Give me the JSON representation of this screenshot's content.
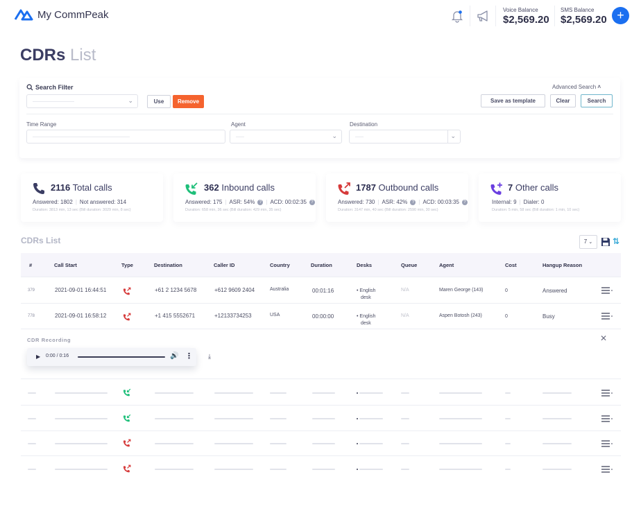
{
  "app": {
    "name": "My CommPeak"
  },
  "header": {
    "notifications_icon": "bell-icon",
    "announcements_icon": "megaphone-icon",
    "voice_balance_label": "Voice Balance",
    "voice_balance_value": "$2,569.20",
    "sms_balance_label": "SMS Balance",
    "sms_balance_value": "$2,569.20",
    "add_label": "+"
  },
  "page": {
    "title_bold": "CDRs",
    "title_light": "List"
  },
  "filter": {
    "search_filter_label": "Search Filter",
    "use_label": "Use",
    "remove_label": "Remove",
    "advanced_search_label": "Advanced Search",
    "save_template_label": "Save as template",
    "clear_label": "Clear",
    "search_label": "Search",
    "time_range_label": "Time Range",
    "agent_label": "Agent",
    "destination_label": "Destination"
  },
  "stats": [
    {
      "count": "2116",
      "label": "Total calls",
      "color": "#3b3d63",
      "parts": [
        "Answered: 1802",
        "Not answered: 314"
      ],
      "duration": "Duration: 3813 min, 13 sec (Bill duration: 3029 min, 8 sec)"
    },
    {
      "count": "362",
      "label": "Inbound calls",
      "color": "#1fbf7a",
      "parts": [
        "Answered: 175",
        "ASR: 54%",
        "ACD: 00:02:35"
      ],
      "duration": "Duration: 658 min, 36 sec (Bill duration: 429 min, 35 sec)"
    },
    {
      "count": "1787",
      "label": "Outbound calls",
      "color": "#d63a3a",
      "parts": [
        "Answered: 730",
        "ASR: 42%",
        "ACD: 00:03:35"
      ],
      "duration": "Duration: 3147 min, 40 sec (Bill duration: 2590 min, 30 sec)"
    },
    {
      "count": "7",
      "label": "Other calls",
      "color": "#6a3fe0",
      "parts": [
        "Internal: 9",
        "Dialer: 0"
      ],
      "duration": "Duration: 5 min, 58 sec (Bill duration: 1 min, 10 sec)"
    }
  ],
  "list": {
    "title": "CDRs List",
    "page_size": "7",
    "columns": [
      "#",
      "Call Start",
      "Type",
      "Destination",
      "Caller ID",
      "Country",
      "Duration",
      "Desks",
      "Queue",
      "Agent",
      "Cost",
      "Hangup Reason"
    ],
    "rows": [
      {
        "id": "379",
        "call_start": "2021-09-01 16:44:51",
        "type": "outbound",
        "destination": "+61 2 1234 5678",
        "caller_id": "+612 9609 2404",
        "country": "Australia",
        "duration": "00:01:16",
        "desk_line1": "• English",
        "desk_line2": "desk",
        "queue": "N/A",
        "agent": "Maren George (143)",
        "cost": "0",
        "hangup_reason": "Answered"
      },
      {
        "id": "778",
        "call_start": "2021-09-01 16:58:12",
        "type": "outbound",
        "destination": "+1 415 5552671",
        "caller_id": "+12133734253",
        "country": "USA",
        "duration": "00:00:00",
        "desk_line1": "• English",
        "desk_line2": "desk",
        "queue": "N/A",
        "agent": "Aspen Botosh (243)",
        "cost": "0",
        "hangup_reason": "Busy"
      }
    ],
    "recording": {
      "label": "CDR Recording",
      "time": "0:00 / 0:16"
    },
    "placeholder_rows": [
      {
        "type": "inbound"
      },
      {
        "type": "inbound"
      },
      {
        "type": "outbound"
      },
      {
        "type": "outbound"
      }
    ]
  },
  "colors": {
    "accent": "#1b6ff0",
    "remove": "#f5632e",
    "inbound": "#1fbf7a",
    "outbound": "#d63a3a",
    "other": "#6a3fe0"
  }
}
